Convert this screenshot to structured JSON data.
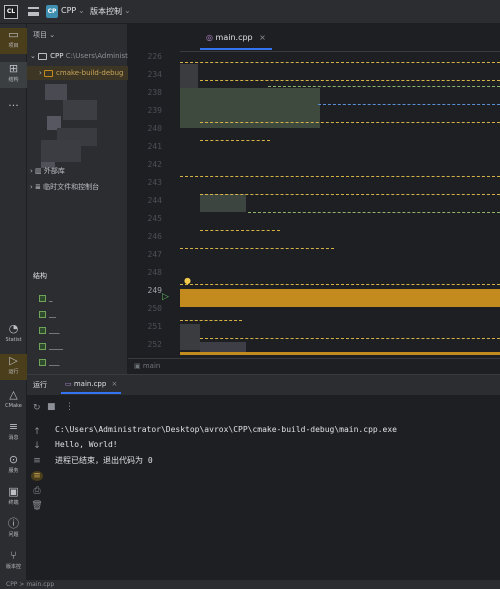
{
  "titlebar": {
    "logo": "CL",
    "project_badge": "CP",
    "project_name": "CPP",
    "vcs_label": "版本控制"
  },
  "leftstrip": {
    "items": [
      {
        "label": "项目",
        "icon": "folder-icon"
      },
      {
        "label": "结构",
        "icon": "structure-icon"
      },
      {
        "label": "...",
        "icon": "more-icon"
      },
      {
        "label": "Statist",
        "icon": "statistic-icon"
      },
      {
        "label": "运行",
        "icon": "run-icon"
      },
      {
        "label": "CMake",
        "icon": "cmake-icon"
      },
      {
        "label": "消息",
        "icon": "messages-icon"
      },
      {
        "label": "服务",
        "icon": "services-icon"
      },
      {
        "label": "终端",
        "icon": "terminal-icon"
      },
      {
        "label": "问题",
        "icon": "problems-icon"
      },
      {
        "label": "版本控",
        "icon": "vcs-icon"
      }
    ]
  },
  "project_panel": {
    "header": "项目",
    "root_name": "CPP",
    "root_path": "C:\\Users\\Administ",
    "child": "cmake-build-debug",
    "external": "外部库",
    "scratches": "临时文件和控制台",
    "structure_title": "结构"
  },
  "editor": {
    "tab_label": "main.cpp",
    "line_numbers": [
      "226",
      "234",
      "238",
      "239",
      "240",
      "241",
      "242",
      "243",
      "244",
      "245",
      "246",
      "247",
      "248",
      "249",
      "250",
      "251",
      "252"
    ],
    "current_line": "249",
    "breadcrumb": "main"
  },
  "run_panel": {
    "title": "运行",
    "tab_label": "main.cpp",
    "output": [
      "C:\\Users\\Administrator\\Desktop\\avrox\\CPP\\cmake-build-debug\\main.cpp.exe",
      "Hello, World!",
      "",
      "进程已结束，退出代码为 0"
    ]
  },
  "status_bar": {
    "project": "CPP",
    "separator": ">",
    "file": "main.cpp"
  },
  "colors": {
    "accent_blue": "#3574f0",
    "highlight_gold": "#c38a1e",
    "background": "#1e1f22",
    "panel": "#2b2d30"
  }
}
